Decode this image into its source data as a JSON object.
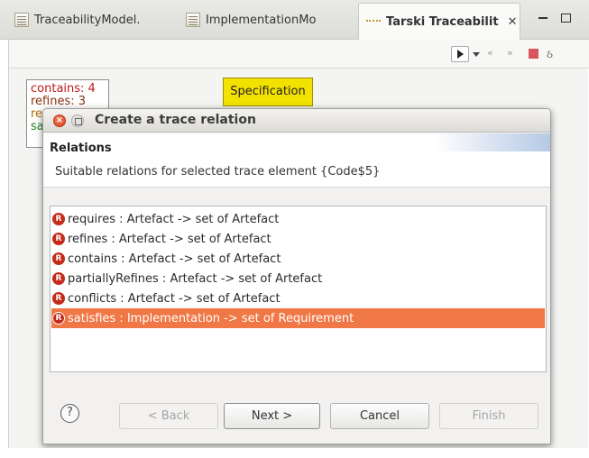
{
  "tabs": [
    {
      "label": "TraceabilityModel.",
      "icon": "file-icon"
    },
    {
      "label": "ImplementationMo",
      "icon": "file-icon"
    },
    {
      "label": "Tarski Traceabilit",
      "icon": "graph-icon",
      "close": "✕",
      "active": true
    }
  ],
  "window": {
    "minimize": "–",
    "maximize": "□"
  },
  "toolbar": {
    "back": "«",
    "forward": "»",
    "tool": "ઠ"
  },
  "canvas": {
    "counts": [
      "contains: 4",
      "refines: 3",
      "re",
      "sa"
    ],
    "spec_label": "Specification"
  },
  "dialog": {
    "title": "Create a trace relation",
    "close_glyph": "×",
    "header_title": "Relations",
    "header_desc": "Suitable relations for selected trace element {Code$5}",
    "relation_icon_letter": "R",
    "relations": [
      "requires : Artefact -> set of Artefact",
      "refines : Artefact -> set of Artefact",
      "contains : Artefact -> set of Artefact",
      "partiallyRefines : Artefact -> set of Artefact",
      "conflicts : Artefact -> set of Artefact",
      "satisfies : Implementation -> set of Requirement"
    ],
    "selected_index": 5,
    "help_glyph": "?",
    "buttons": {
      "back": "< Back",
      "next": "Next >",
      "cancel": "Cancel",
      "finish": "Finish"
    }
  },
  "colors": {
    "selection": "#f07746",
    "spec_box": "#f3e100",
    "relation_icon": "#c52a1c"
  }
}
